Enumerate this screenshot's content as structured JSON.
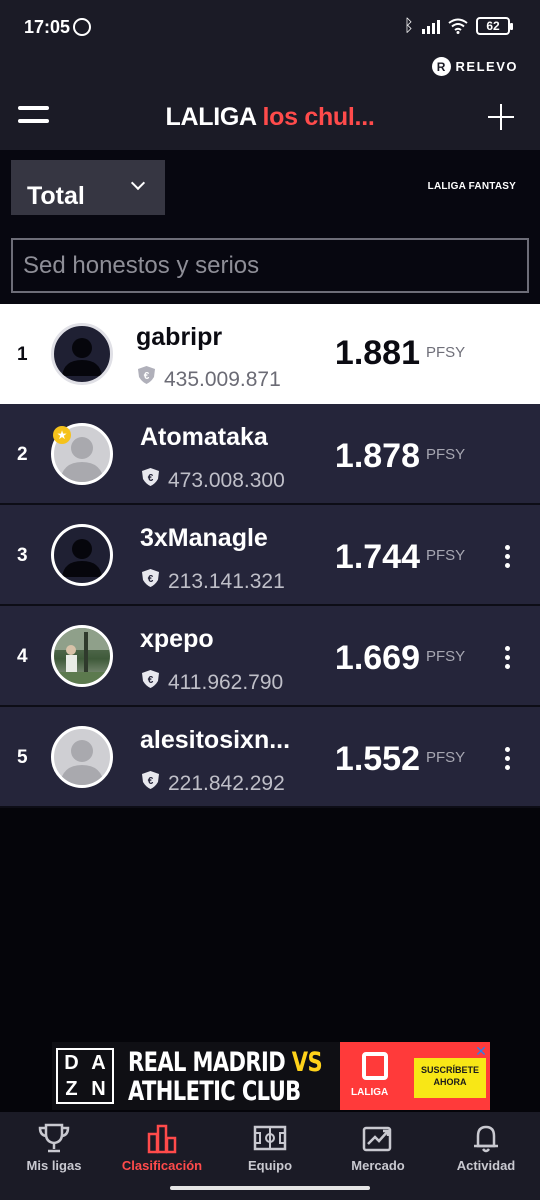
{
  "status_bar": {
    "time": "17:05",
    "battery": "62"
  },
  "brand": {
    "relevo": "RELEVO",
    "fantasy_logo": "LALIGA FANTASY"
  },
  "header": {
    "title_part1": "LALIGA ",
    "title_part2": "los chul..."
  },
  "filters": {
    "selected_view": "Total",
    "search_placeholder": "Sed honestos y serios"
  },
  "ranking": [
    {
      "position": "1",
      "name": "gabripr",
      "money": "435.009.871",
      "points": "1.881",
      "unit": "PFSY",
      "highlight": true,
      "avatar": "default-dark",
      "has_star": false,
      "has_menu": false
    },
    {
      "position": "2",
      "name": "Atomataka",
      "money": "473.008.300",
      "points": "1.878",
      "unit": "PFSY",
      "highlight": false,
      "avatar": "default-grey",
      "has_star": true,
      "has_menu": false
    },
    {
      "position": "3",
      "name": "3xManagle",
      "money": "213.141.321",
      "points": "1.744",
      "unit": "PFSY",
      "highlight": false,
      "avatar": "default-dark",
      "has_star": false,
      "has_menu": true
    },
    {
      "position": "4",
      "name": "xpepo",
      "money": "411.962.790",
      "points": "1.669",
      "unit": "PFSY",
      "highlight": false,
      "avatar": "photo",
      "has_star": false,
      "has_menu": true
    },
    {
      "position": "5",
      "name": "alesitosixn...",
      "money": "221.842.292",
      "points": "1.552",
      "unit": "PFSY",
      "highlight": false,
      "avatar": "default-grey",
      "has_star": false,
      "has_menu": true
    }
  ],
  "ad": {
    "dazn_letters": [
      "D",
      "A",
      "Z",
      "N"
    ],
    "match_line1": "REAL MADRID ",
    "match_vs": "VS",
    "match_line2": "ATHLETIC CLUB",
    "laliga_text": "LALIGA",
    "cta_line1": "SUSCRÍBETE",
    "cta_line2": "AHORA",
    "close": "✕"
  },
  "nav": [
    {
      "label": "Mis ligas",
      "icon": "trophy-icon",
      "active": false
    },
    {
      "label": "Clasificación",
      "icon": "ranking-bars-icon",
      "active": true
    },
    {
      "label": "Equipo",
      "icon": "field-icon",
      "active": false
    },
    {
      "label": "Mercado",
      "icon": "market-icon",
      "active": false
    },
    {
      "label": "Actividad",
      "icon": "bell-icon",
      "active": false
    }
  ],
  "colors": {
    "accent_red": "#ff4b4b",
    "row_bg": "#25253a",
    "header_bg": "#1b1b26"
  }
}
